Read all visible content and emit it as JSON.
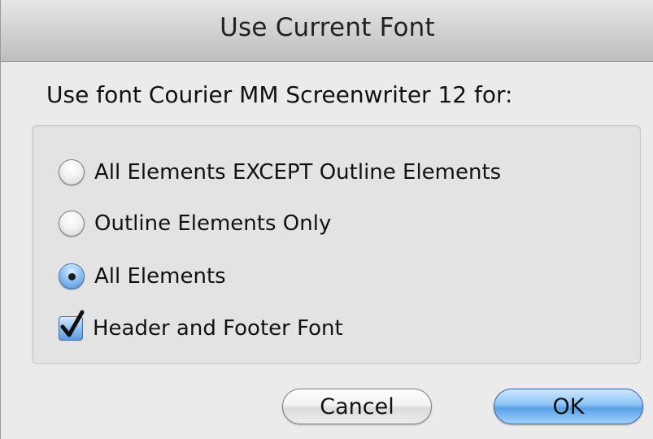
{
  "dialog": {
    "title": "Use Current Font",
    "prompt": "Use font Courier MM Screenwriter 12 for:"
  },
  "options": {
    "radio": [
      {
        "label": "All Elements EXCEPT Outline Elements",
        "selected": false
      },
      {
        "label": "Outline Elements Only",
        "selected": false
      },
      {
        "label": "All Elements",
        "selected": true
      }
    ],
    "checkbox": {
      "label": "Header and Footer Font",
      "checked": true
    }
  },
  "buttons": {
    "cancel_label": "Cancel",
    "ok_label": "OK"
  },
  "colors": {
    "accent": "#5aa1e8",
    "window_bg": "#ebebeb",
    "group_bg": "#e3e3e3"
  },
  "icons": {
    "radio_unselected": "radio-unselected-icon",
    "radio_selected": "radio-selected-icon",
    "checkbox_checked": "checkmark-icon"
  }
}
